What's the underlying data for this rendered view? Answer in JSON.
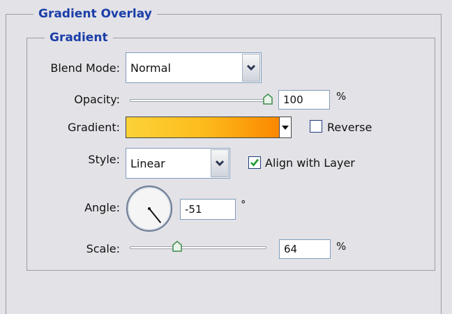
{
  "panel": {
    "title": "Gradient Overlay"
  },
  "group": {
    "title": "Gradient"
  },
  "blend_mode": {
    "label": "Blend Mode:",
    "value": "Normal"
  },
  "opacity": {
    "label": "Opacity:",
    "value": "100",
    "unit": "%",
    "level": 1.0
  },
  "gradient": {
    "label": "Gradient:",
    "colors": [
      "#fbd238",
      "#fdbc1c",
      "#fb8800"
    ],
    "reverse_label": "Reverse",
    "reverse_checked": false
  },
  "style": {
    "label": "Style:",
    "value": "Linear",
    "align_label": "Align with Layer",
    "align_checked": true
  },
  "angle": {
    "label": "Angle:",
    "value": "-51",
    "unit": "°",
    "degrees": -51
  },
  "scale": {
    "label": "Scale:",
    "value": "64",
    "unit": "%"
  },
  "icons": {
    "dropdown": "chevron-down-icon",
    "check": "checkmark-icon",
    "slider_thumb": "slider-thumb-icon"
  }
}
